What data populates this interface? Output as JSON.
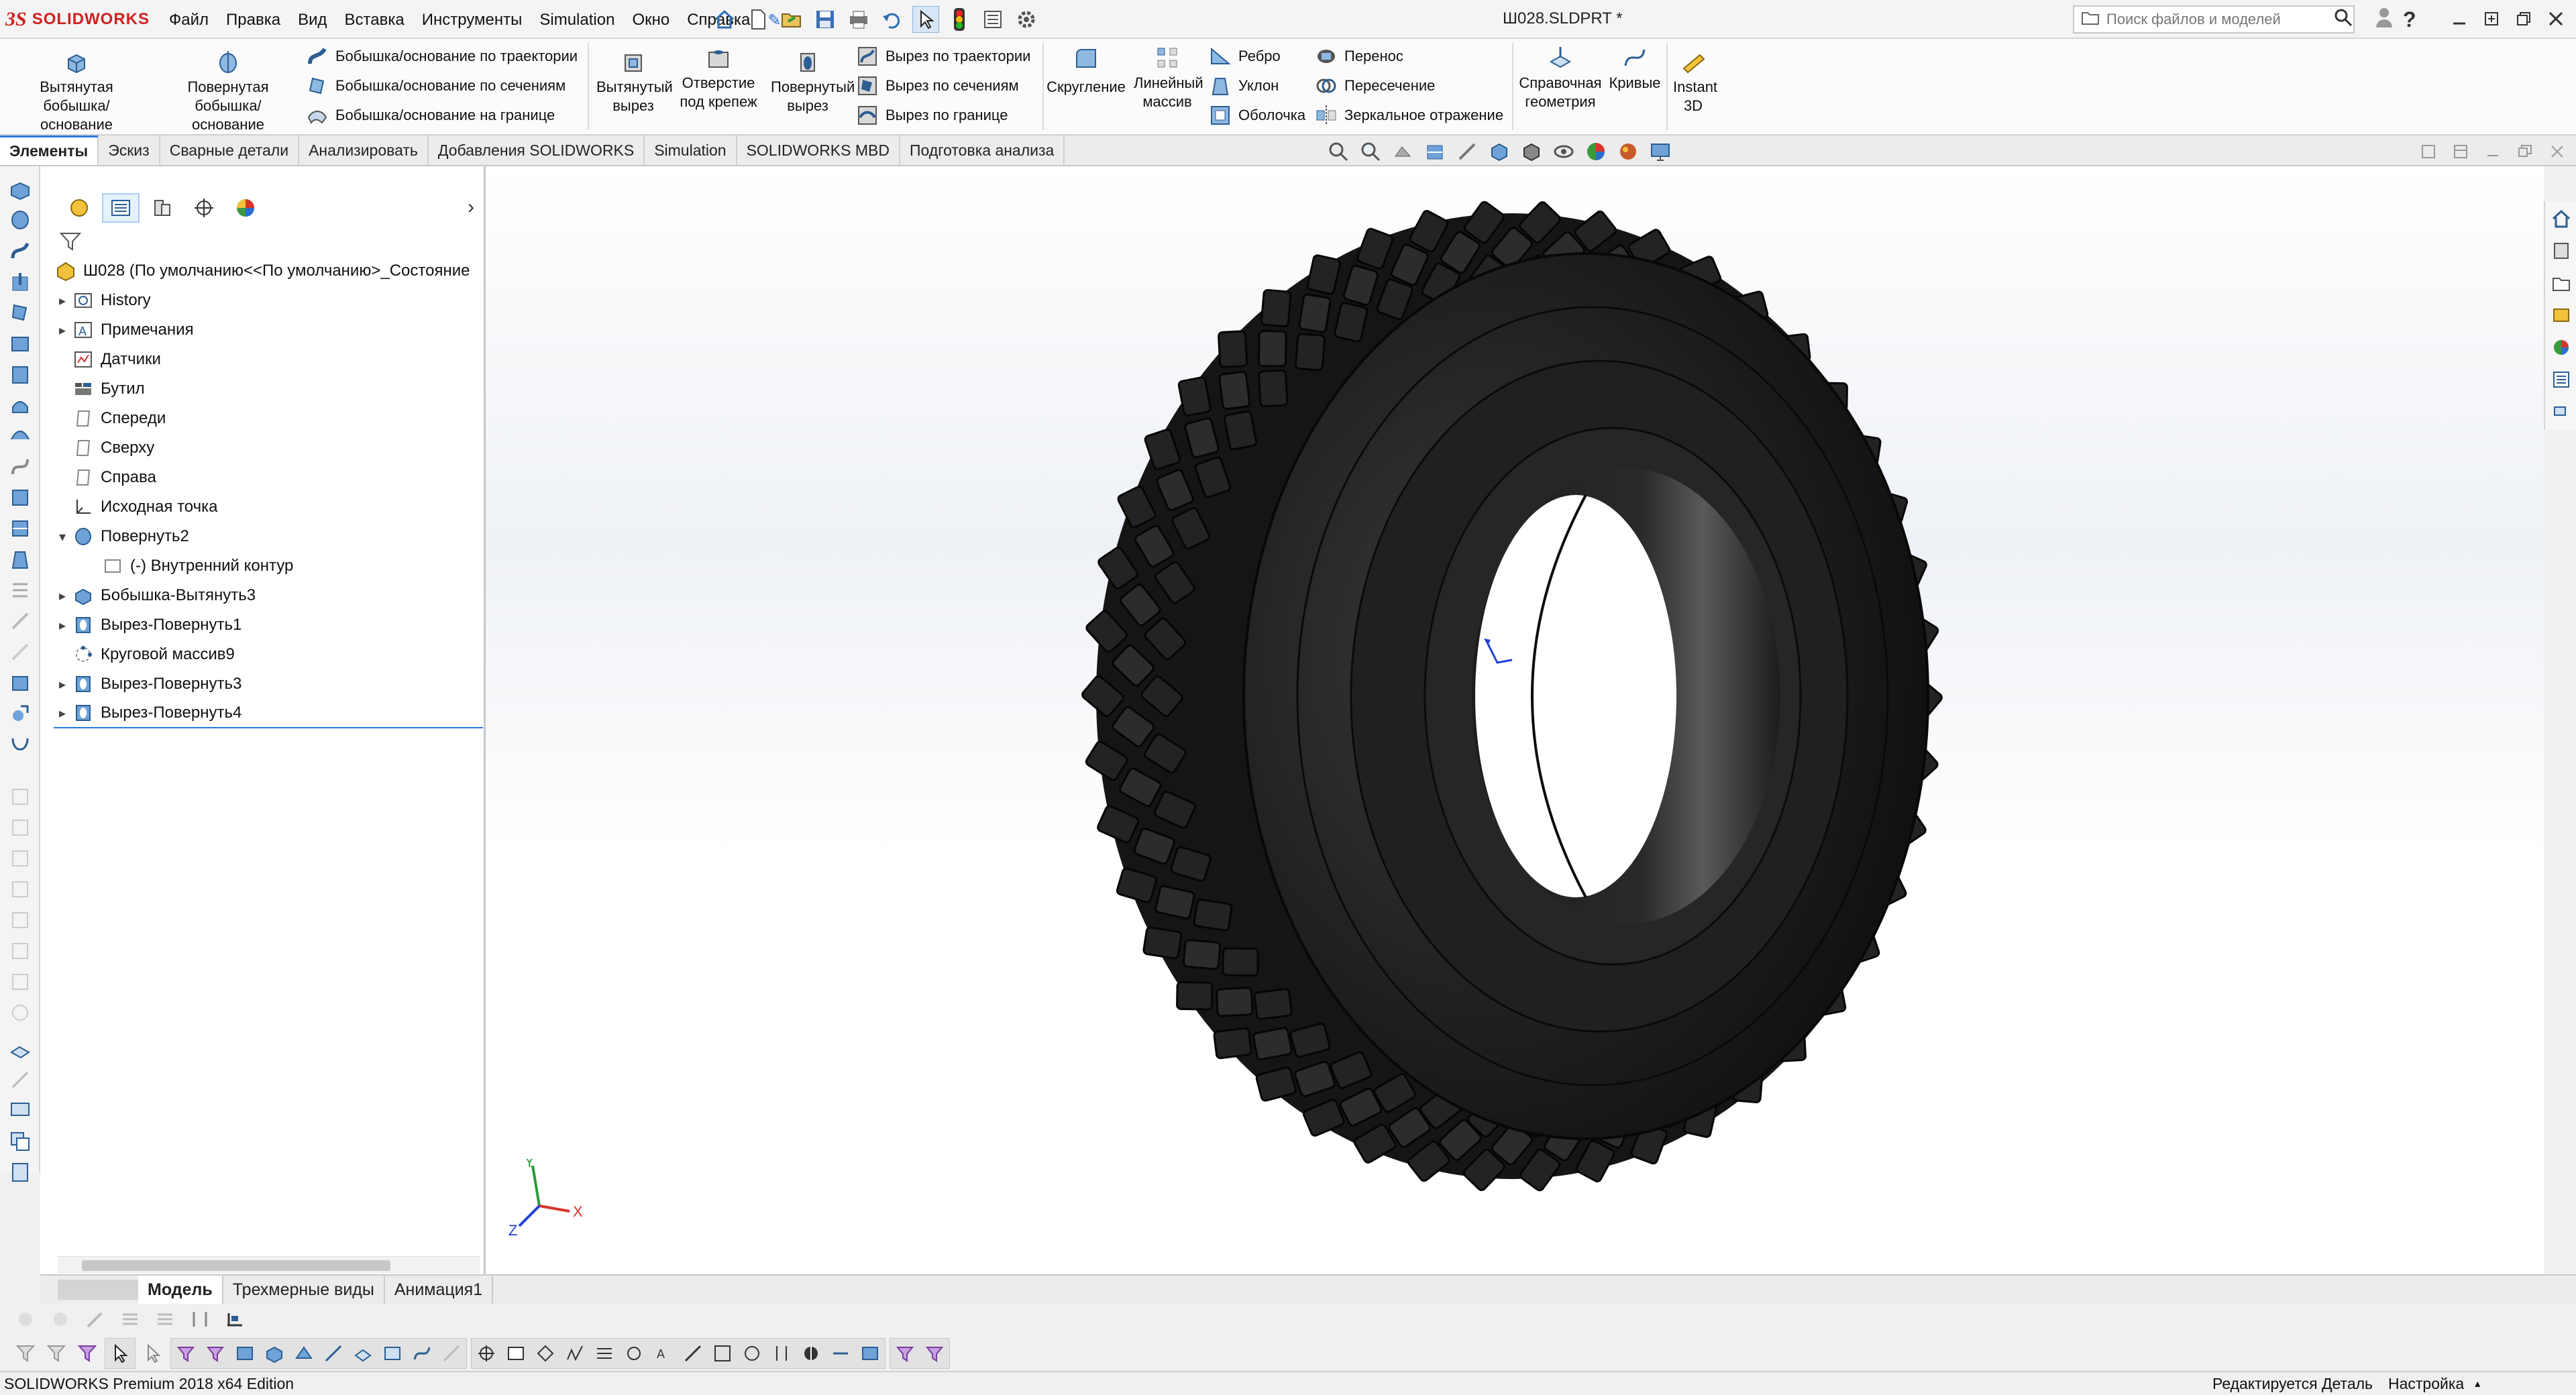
{
  "app": {
    "brand_ds": "3S",
    "brand_name": "SOLIDWORKS",
    "document_title": "Ш028.SLDPRT *"
  },
  "menu": [
    "Файл",
    "Правка",
    "Вид",
    "Вставка",
    "Инструменты",
    "Simulation",
    "Окно",
    "Справка"
  ],
  "search": {
    "placeholder": "Поиск файлов и моделей"
  },
  "ribbon": {
    "extruded_boss": "Вытянутая бобышка/основание",
    "revolved_boss": "Повернутая бобышка/основание",
    "swept_boss": "Бобышка/основание по траектории",
    "lofted_boss": "Бобышка/основание по сечениям",
    "boundary_boss": "Бобышка/основание на границе",
    "extruded_cut": "Вытянутый вырез",
    "hole_wizard": "Отверстие под крепеж",
    "revolved_cut": "Повернутый вырез",
    "swept_cut": "Вырез по траектории",
    "lofted_cut": "Вырез по сечениям",
    "boundary_cut": "Вырез по границе",
    "fillet": "Скругление",
    "linear_pattern": "Линейный массив",
    "rib": "Ребро",
    "draft": "Уклон",
    "shell": "Оболочка",
    "wrap": "Перенос",
    "intersect": "Пересечение",
    "mirror": "Зеркальное отражение",
    "reference_geometry": "Справочная геометрия",
    "curves": "Кривые",
    "instant3d": "Instant 3D"
  },
  "command_tabs": [
    "Элементы",
    "Эскиз",
    "Сварные детали",
    "Анализировать",
    "Добавления SOLIDWORKS",
    "Simulation",
    "SOLIDWORKS MBD",
    "Подготовка анализа"
  ],
  "active_command_tab": "Элементы",
  "tree": {
    "root": "Ш028  (По умолчанию<<По умолчанию>_Состояние",
    "items": [
      {
        "label": "History",
        "expandable": true,
        "icon": "history-icon",
        "indent": 0
      },
      {
        "label": "Примечания",
        "expandable": true,
        "icon": "annotations-icon",
        "indent": 0
      },
      {
        "label": "Датчики",
        "expandable": false,
        "icon": "sensors-icon",
        "indent": 0
      },
      {
        "label": "Бутил",
        "expandable": false,
        "icon": "material-icon",
        "indent": 0
      },
      {
        "label": "Спереди",
        "expandable": false,
        "icon": "plane-icon",
        "indent": 0
      },
      {
        "label": "Сверху",
        "expandable": false,
        "icon": "plane-icon",
        "indent": 0
      },
      {
        "label": "Справа",
        "expandable": false,
        "icon": "plane-icon",
        "indent": 0
      },
      {
        "label": "Исходная точка",
        "expandable": false,
        "icon": "origin-icon",
        "indent": 0
      },
      {
        "label": "Повернуть2",
        "expandable": true,
        "expanded": true,
        "icon": "revolve-icon",
        "indent": 0
      },
      {
        "label": "(-) Внутренний контур",
        "expandable": false,
        "icon": "sketch-icon",
        "indent": 1
      },
      {
        "label": "Бобышка-Вытянуть3",
        "expandable": true,
        "icon": "extrude-icon",
        "indent": 0
      },
      {
        "label": "Вырез-Повернуть1",
        "expandable": true,
        "icon": "cut-revolve-icon",
        "indent": 0
      },
      {
        "label": "Круговой массив9",
        "expandable": false,
        "icon": "circular-pattern-icon",
        "indent": 0
      },
      {
        "label": "Вырез-Повернуть3",
        "expandable": true,
        "icon": "cut-revolve-icon",
        "indent": 0
      },
      {
        "label": "Вырез-Повернуть4",
        "expandable": true,
        "icon": "cut-revolve-icon",
        "indent": 0
      }
    ]
  },
  "model_tabs": [
    "Модель",
    "Трехмерные виды",
    "Анимация1"
  ],
  "active_model_tab": "Модель",
  "triad": {
    "x": "X",
    "y": "Y",
    "z": "Z"
  },
  "status": {
    "edition": "SOLIDWORKS Premium 2018 x64 Edition",
    "mode": "Редактируется Деталь",
    "units": "Настройка"
  },
  "colors": {
    "brand_red": "#d0201e",
    "accent_blue": "#2a7be0",
    "tire": "#1e1e1e"
  }
}
